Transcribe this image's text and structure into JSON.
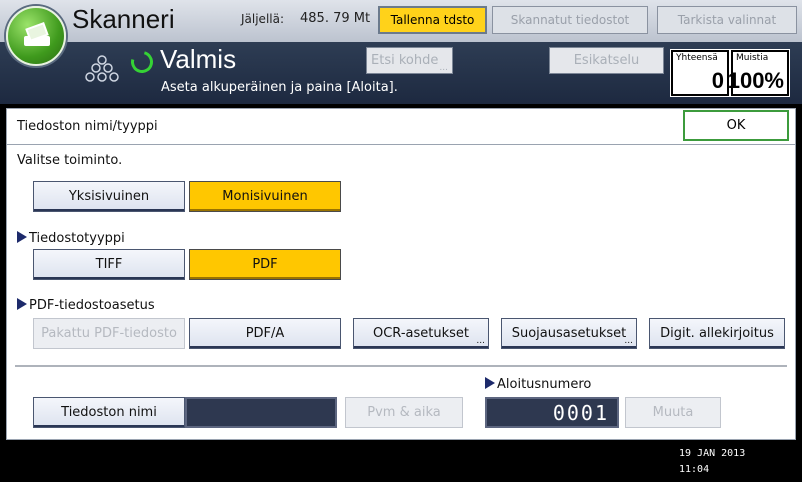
{
  "header": {
    "app_title": "Skanneri",
    "remaining_label": "Jäljellä:",
    "remaining_value": "485. 79 Mt",
    "save_file_button": "Tallenna tdsto",
    "scanned_files_button": "Skannatut tiedostot",
    "check_settings_button": "Tarkista valinnat",
    "status_title": "Valmis",
    "status_message": "Aseta alkuperäinen ja paina [Aloita].",
    "search_dest_button": "Etsi kohde",
    "preview_button": "Esikatselu",
    "total_counter_label": "Yhteensä",
    "total_counter_value": "0",
    "memory_counter_label": "Muistia",
    "memory_counter_value": "100%"
  },
  "panel": {
    "title": "Tiedoston nimi/tyyppi",
    "ok_label": "OK",
    "select_function_label": "Valitse toiminto.",
    "single_page": "Yksisivuinen",
    "multi_page": "Monisivuinen",
    "file_type_label": "Tiedostotyyppi",
    "tiff": "TIFF",
    "pdf": "PDF",
    "pdf_settings_label": "PDF-tiedostoasetus",
    "compressed_pdf": "Pakattu PDF-tiedosto",
    "pdf_a": "PDF/A",
    "ocr_settings": "OCR-asetukset",
    "security_settings": "Suojausasetukset",
    "digital_signature": "Digit. allekirjoitus",
    "start_number_label": "Aloitusnumero",
    "file_name_button": "Tiedoston nimi",
    "date_time_button": "Pvm & aika",
    "start_number_value": "0001",
    "change_button": "Muuta",
    "ellipsis": "..."
  },
  "footer": {
    "date": "19 JAN  2013",
    "time": "11:04"
  },
  "colors": {
    "selected": "#ffc700",
    "active_header": "#ffd21a",
    "ok_border": "#3c9b3c"
  }
}
